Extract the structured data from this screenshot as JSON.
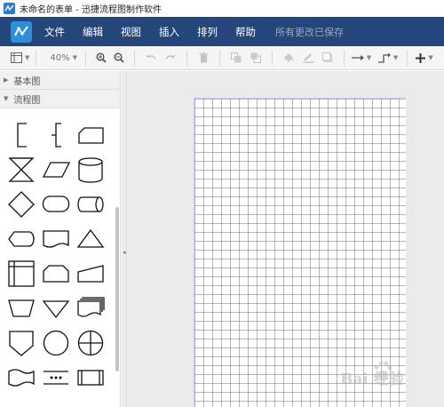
{
  "window": {
    "title": "未命名的表单 - 迅捷流程图制作软件"
  },
  "menubar": {
    "items": [
      "文件",
      "编辑",
      "视图",
      "插入",
      "排列",
      "帮助"
    ],
    "status": "所有更改已保存"
  },
  "toolbar": {
    "zoom": "40%",
    "buttons": [
      "page-layout",
      "zoom-in",
      "zoom-out",
      "undo",
      "redo",
      "delete",
      "to-front",
      "to-back",
      "fill-color",
      "line-color",
      "shadow",
      "connection-style",
      "waypoints",
      "insert"
    ]
  },
  "sidebar": {
    "sections": [
      {
        "label": "基本图",
        "expanded": false
      },
      {
        "label": "流程图",
        "expanded": true
      }
    ],
    "shapes": [
      "annotation-bracket",
      "annotation-brace",
      "card",
      "collate",
      "data-parallelogram",
      "database-cylinder",
      "decision-diamond",
      "terminator",
      "direct-data",
      "display",
      "document",
      "extract-triangle",
      "internal-storage",
      "loop-limit",
      "manual-input",
      "manual-operation",
      "merge-triangle",
      "multi-document",
      "off-page-connector",
      "on-page-connector",
      "summing-junction",
      "punched-tape",
      "parallel-mode",
      "predefined-process"
    ]
  },
  "watermark": {
    "text": "Bai 经验"
  },
  "colors": {
    "menubar": "#25467a",
    "accent": "#2f8ed8",
    "grid": "#6e6ed7",
    "canvas_bg": "#ebebeb"
  }
}
